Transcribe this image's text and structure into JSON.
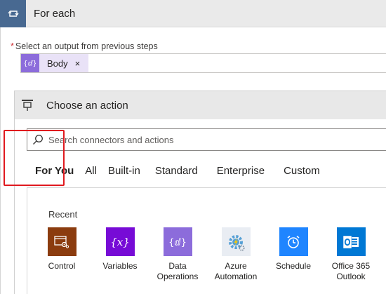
{
  "foreach": {
    "title": "For each",
    "icon": "loop-icon",
    "color": "#486991"
  },
  "select_output": {
    "required_mark": "*",
    "label": "Select an output from previous steps",
    "token": {
      "label": "Body",
      "icon": "expression-icon",
      "close": "×",
      "color": "#8c6cdb"
    }
  },
  "choose_action": {
    "title": "Choose an action",
    "icon": "action-icon",
    "search": {
      "placeholder": "Search connectors and actions",
      "value": ""
    },
    "tabs": [
      {
        "label": "For You",
        "active": true
      },
      {
        "label": "All",
        "active": false
      },
      {
        "label": "Built-in",
        "active": false
      },
      {
        "label": "Standard",
        "active": false
      },
      {
        "label": "Enterprise",
        "active": false
      },
      {
        "label": "Custom",
        "active": false
      }
    ],
    "recent_label": "Recent",
    "tiles": [
      {
        "label": "Control",
        "icon": "control-icon",
        "color": "#8b3c0f",
        "selected": true
      },
      {
        "label": "Variables",
        "icon": "variables-icon",
        "color": "#770bd6"
      },
      {
        "label": "Data Operations",
        "icon": "data-operations-icon",
        "color": "#8c6cdb"
      },
      {
        "label": "Azure Automation",
        "icon": "azure-automation-icon",
        "color": "#56a0d6"
      },
      {
        "label": "Schedule",
        "icon": "schedule-icon",
        "color": "#1f85ff"
      },
      {
        "label": "Office 365 Outlook",
        "icon": "outlook-icon",
        "color": "#0078d4"
      }
    ]
  }
}
